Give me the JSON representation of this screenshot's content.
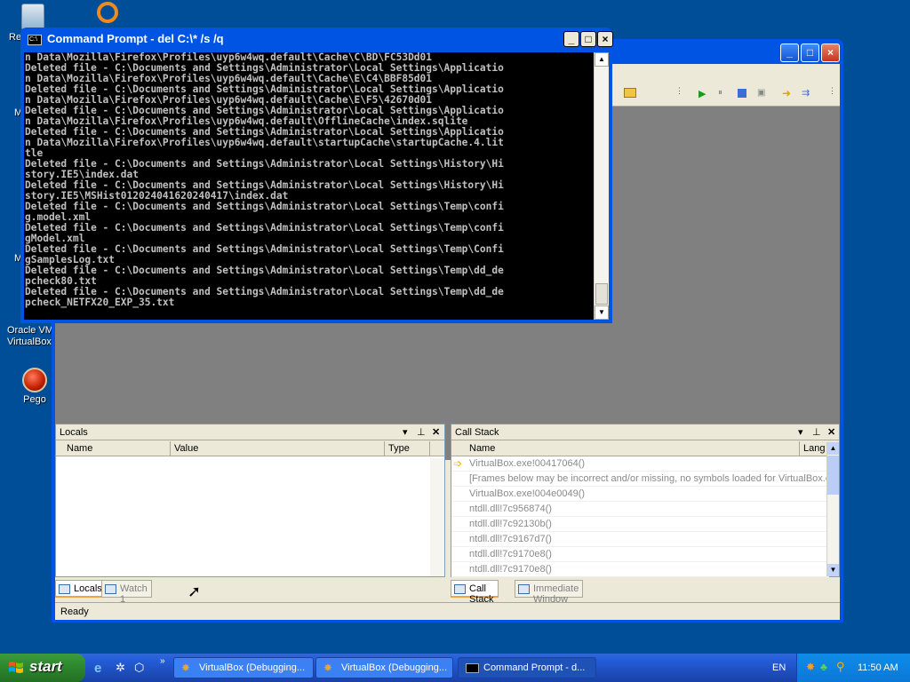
{
  "desktop": {
    "icons": [
      {
        "label": "Re"
      },
      {
        "label": "Oracle VM VirtualBox"
      },
      {
        "label": "Pego"
      }
    ],
    "side_letters": [
      "M",
      "M"
    ]
  },
  "cmd": {
    "title": "Command Prompt - del C:\\* /s /q",
    "lines": [
      "n Data\\Mozilla\\Firefox\\Profiles\\uyp6w4wq.default\\Cache\\C\\BD\\FC53Dd01",
      "Deleted file - C:\\Documents and Settings\\Administrator\\Local Settings\\Applicatio",
      "n Data\\Mozilla\\Firefox\\Profiles\\uyp6w4wq.default\\Cache\\E\\C4\\BBF85d01",
      "Deleted file - C:\\Documents and Settings\\Administrator\\Local Settings\\Applicatio",
      "n Data\\Mozilla\\Firefox\\Profiles\\uyp6w4wq.default\\Cache\\E\\F5\\42670d01",
      "Deleted file - C:\\Documents and Settings\\Administrator\\Local Settings\\Applicatio",
      "n Data\\Mozilla\\Firefox\\Profiles\\uyp6w4wq.default\\OfflineCache\\index.sqlite",
      "Deleted file - C:\\Documents and Settings\\Administrator\\Local Settings\\Applicatio",
      "n Data\\Mozilla\\Firefox\\Profiles\\uyp6w4wq.default\\startupCache\\startupCache.4.lit",
      "tle",
      "Deleted file - C:\\Documents and Settings\\Administrator\\Local Settings\\History\\Hi",
      "story.IE5\\index.dat",
      "Deleted file - C:\\Documents and Settings\\Administrator\\Local Settings\\History\\Hi",
      "story.IE5\\MSHist012024041620240417\\index.dat",
      "Deleted file - C:\\Documents and Settings\\Administrator\\Local Settings\\Temp\\confi",
      "g.model.xml",
      "Deleted file - C:\\Documents and Settings\\Administrator\\Local Settings\\Temp\\confi",
      "gModel.xml",
      "Deleted file - C:\\Documents and Settings\\Administrator\\Local Settings\\Temp\\Confi",
      "gSamplesLog.txt",
      "Deleted file - C:\\Documents and Settings\\Administrator\\Local Settings\\Temp\\dd_de",
      "pcheck80.txt",
      "Deleted file - C:\\Documents and Settings\\Administrator\\Local Settings\\Temp\\dd_de",
      "pcheck_NETFX20_EXP_35.txt"
    ]
  },
  "locals": {
    "title": "Locals",
    "columns": [
      "Name",
      "Value",
      "Type"
    ]
  },
  "callstack": {
    "title": "Call Stack",
    "columns": [
      "Name",
      "Lang"
    ],
    "rows": [
      "VirtualBox.exe!00417064()",
      "[Frames below may be incorrect and/or missing, no symbols loaded for VirtualBox.exe]",
      "VirtualBox.exe!004e0049()",
      "ntdll.dll!7c956874()",
      "ntdll.dll!7c92130b()",
      "ntdll.dll!7c9167d7()",
      "ntdll.dll!7c9170e8()",
      "ntdll.dll!7c9170e8()"
    ]
  },
  "tabs_left": [
    "Locals",
    "Watch 1"
  ],
  "tabs_right": [
    "Call Stack",
    "Immediate Window"
  ],
  "status": "Ready",
  "taskbar": {
    "start": "start",
    "tasks": [
      "VirtualBox (Debugging...",
      "VirtualBox (Debugging...",
      "Command Prompt - d..."
    ],
    "lang": "EN",
    "clock": "11:50 AM"
  }
}
